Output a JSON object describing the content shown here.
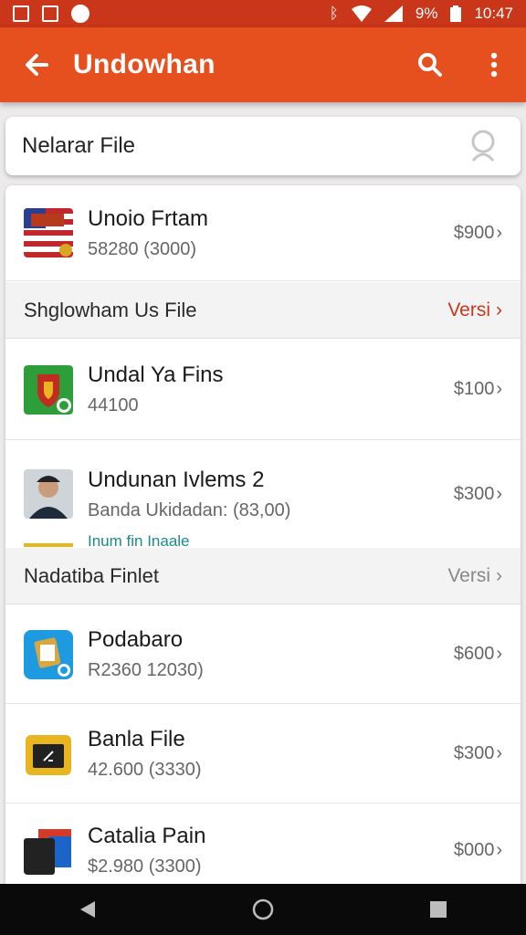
{
  "status_bar": {
    "left_icons": [
      "image-icon",
      "gallery-icon",
      "circle-app-icon"
    ],
    "battery": "9%",
    "time": "10:47"
  },
  "app_bar": {
    "title": "Undowhan"
  },
  "search": {
    "text": "Nelarar File"
  },
  "items_top": [
    {
      "name": "Unoio Frtam",
      "sub": "58280  (3000)",
      "price": "$900",
      "thumb": "flag-thumb"
    }
  ],
  "section1": {
    "label": "Shglowham Us File",
    "link": "Versi",
    "link_color": "#c9361a"
  },
  "items_mid": [
    {
      "name": "Undal Ya Fins",
      "sub": "44100",
      "price": "$100",
      "thumb": "shield-thumb"
    },
    {
      "name": "Undunan Ivlems 2",
      "sub": "Banda Ukidadan: (83,00)",
      "price": "$300",
      "thumb": "person-thumb"
    }
  ],
  "cut_text": "Inum fin Inaale",
  "section2": {
    "label": "Nadatiba Finlet",
    "link": "Versi",
    "link_color": "#888888"
  },
  "items_bottom": [
    {
      "name": "Podabaro",
      "sub": "R2360  12030)",
      "price": "$600",
      "thumb": "blue-app-thumb"
    },
    {
      "name": "Banla File",
      "sub": "42.600  (3330)",
      "price": "$300",
      "thumb": "folder-thumb"
    },
    {
      "name": "Catalia Pain",
      "sub": "$2.980  (3300)",
      "price": "$000",
      "thumb": "cube-thumb"
    }
  ],
  "colors": {
    "status_bar": "#c9361a",
    "app_bar": "#e6501f",
    "accent": "#c9361a"
  }
}
